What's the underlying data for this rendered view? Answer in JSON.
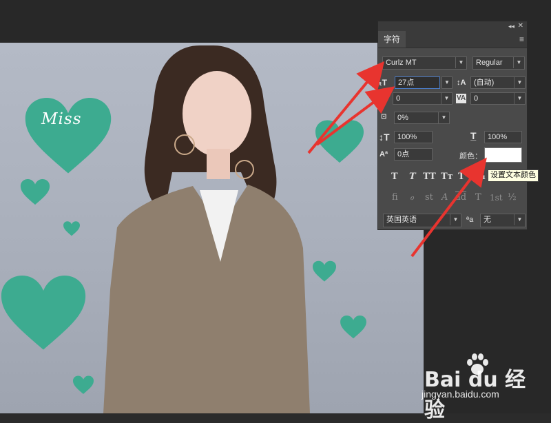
{
  "panel": {
    "tab_label": "字符",
    "collapse_glyph": "◂◂",
    "close_glyph": "✕",
    "menu_glyph": "≡",
    "font_family": "Curlz MT",
    "font_style": "Regular",
    "font_size": "27点",
    "leading": "(自动)",
    "kerning": "0",
    "tracking": "0",
    "tsume": "0%",
    "vertical_scale": "100%",
    "horizontal_scale": "100%",
    "baseline_shift": "0点",
    "color_label": "颜色：",
    "color_value": "#ffffff",
    "tooltip": "设置文本颜色",
    "language": "英国英语",
    "antialias_label": "ªa",
    "antialias": "无",
    "style_buttons": [
      "T",
      "T",
      "TT",
      "Tт",
      "T¹",
      "T₁"
    ],
    "opentype_buttons": [
      "fi",
      "ℴ",
      "st",
      "A",
      "ad",
      "T",
      "1st",
      "½"
    ]
  },
  "canvas": {
    "text_layer": "Miss",
    "heart_color": "#3dab90"
  },
  "watermark": {
    "main": "Bai du 经验",
    "sub": "jingyan.baidu.com"
  },
  "accent": {
    "arrow_color": "#e8342f"
  }
}
